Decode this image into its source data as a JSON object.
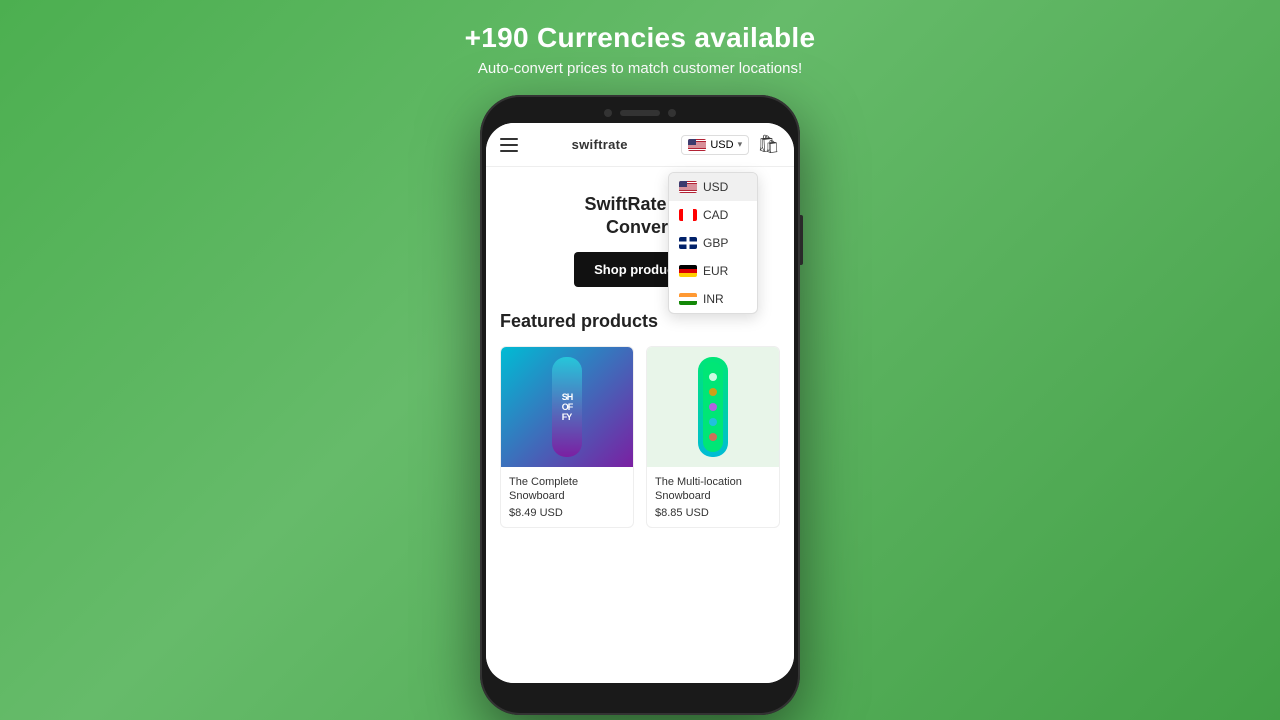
{
  "background_color": "#5cb85c",
  "header": {
    "title": "+190 Currencies available",
    "subtitle": "Auto-convert prices to match customer locations!"
  },
  "phone": {
    "brand": "swiftrate",
    "currency_selector": {
      "current": "USD",
      "chevron": "▾"
    },
    "currency_dropdown": {
      "options": [
        {
          "code": "USD",
          "flag": "us"
        },
        {
          "code": "CAD",
          "flag": "ca"
        },
        {
          "code": "GBP",
          "flag": "gb"
        },
        {
          "code": "EUR",
          "flag": "de"
        },
        {
          "code": "INR",
          "flag": "in"
        }
      ]
    },
    "hero": {
      "title_line1": "SwiftRate Cu",
      "title_line2": "Convert",
      "button_label": "Shop products"
    },
    "featured": {
      "section_title": "Featured products",
      "products": [
        {
          "name": "The Complete Snowboard",
          "price": "$8.49 USD",
          "color": "teal_purple",
          "label": "SHOFY"
        },
        {
          "name": "The Multi-location Snowboard",
          "price": "$8.85 USD",
          "color": "green_teal",
          "label": ""
        }
      ]
    }
  }
}
